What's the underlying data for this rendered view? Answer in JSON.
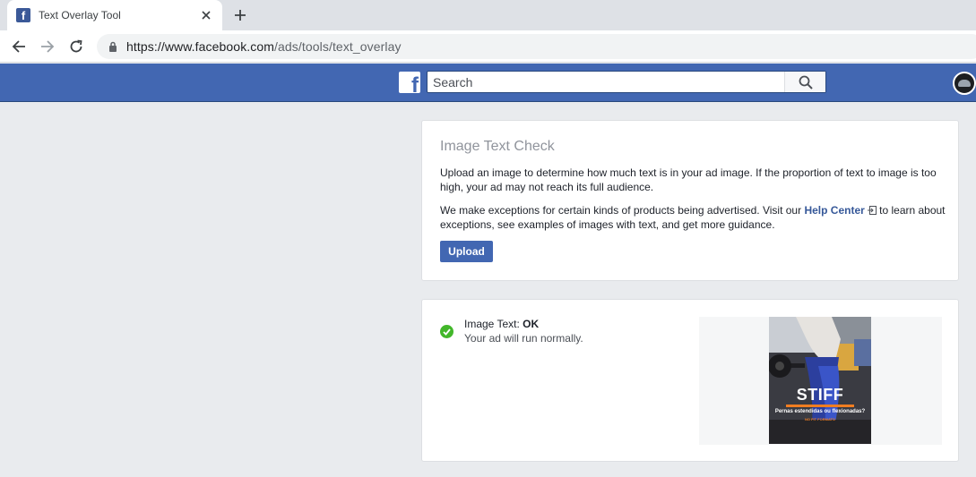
{
  "browser": {
    "tab_title": "Text Overlay Tool",
    "url_host": "https://www.facebook.com",
    "url_path": "/ads/tools/text_overlay"
  },
  "fb": {
    "search_placeholder": "Search",
    "brand_color": "#4267b2"
  },
  "text_check": {
    "title": "Image Text Check",
    "para1": "Upload an image to determine how much text is in your ad image. If the proportion of text to image is too high, your ad may not reach its full audience.",
    "para2_before": "We make exceptions for certain kinds of products being advertised. Visit our ",
    "help_link": "Help Center",
    "para2_after": " to learn about exceptions, see examples of images with text, and get more guidance.",
    "upload_label": "Upload"
  },
  "result": {
    "label": "Image Text: ",
    "status": "OK",
    "message": "Your ad will run normally.",
    "status_color": "#42b72a",
    "ad_image": {
      "headline": "STIFF",
      "subline": "Pernas estendidas ou flexionadas?",
      "brand": "NO FIT FORMATO"
    }
  },
  "icons": [
    "facebook-favicon",
    "close-icon",
    "plus-icon",
    "back-arrow-icon",
    "forward-arrow-icon",
    "reload-icon",
    "lock-icon",
    "facebook-logo",
    "search-icon",
    "external-link-icon",
    "check-circle-icon"
  ]
}
